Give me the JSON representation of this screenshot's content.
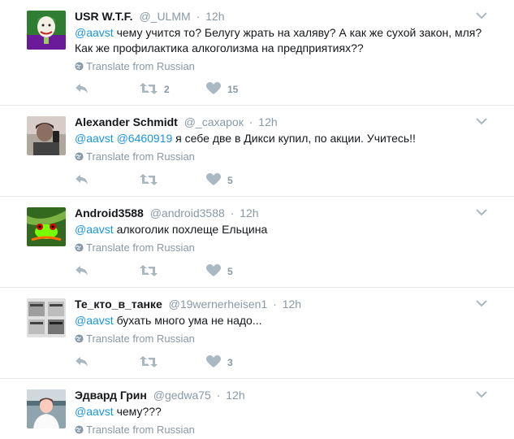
{
  "translate_label": "Translate from Russian",
  "colors": {
    "link": "#1b95e0",
    "muted": "#8899a6",
    "icon": "#aab8c2"
  },
  "tweets": [
    {
      "name": "USR W.T.F.",
      "handle": "@_ULMM",
      "dot": "·",
      "time": "12h",
      "mention": "@aavst",
      "mention2": "",
      "body": " чему учится то? Белугу жрать на халяву? А как же сухой закон, мля? Как же профилактика алкоголизма на предприятиях??",
      "retweets": "2",
      "likes": "15",
      "avatar_icon": "joker-avatar-icon"
    },
    {
      "name": "Alexander Schmidt",
      "handle": "@_сахарок",
      "dot": "·",
      "time": "12h",
      "mention": "@aavst",
      "mention2": "@6460919",
      "body": " я себе две в Дикси купил, по акции. Учитесь!!",
      "retweets": "",
      "likes": "5",
      "avatar_icon": "selfie-avatar-icon"
    },
    {
      "name": "Android3588",
      "handle": "@android3588",
      "dot": "·",
      "time": "12h",
      "mention": "@aavst",
      "mention2": "",
      "body": " алкоголик похлеще Ельцина",
      "retweets": "",
      "likes": "5",
      "avatar_icon": "frog-avatar-icon"
    },
    {
      "name": "Те_кто_в_танке",
      "handle": "@19wernerheisen1",
      "dot": "·",
      "time": "12h",
      "mention": "@aavst",
      "mention2": "",
      "body": " бухать много ума не надо...",
      "retweets": "",
      "likes": "3",
      "avatar_icon": "newspaper-avatar-icon"
    },
    {
      "name": "Эдвард Грин",
      "handle": "@gedwa75",
      "dot": "·",
      "time": "12h",
      "mention": "@aavst",
      "mention2": "",
      "body": " чему???",
      "retweets": "",
      "likes": "",
      "avatar_icon": "man-avatar-icon"
    }
  ]
}
